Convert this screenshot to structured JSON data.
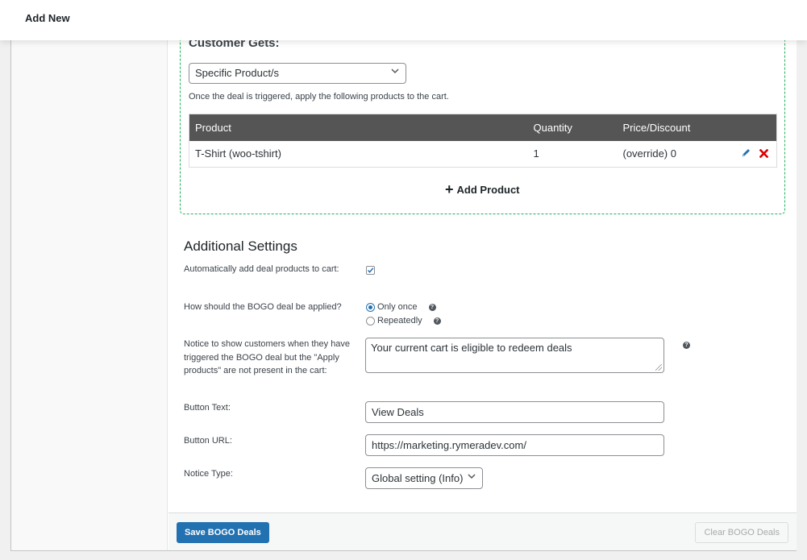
{
  "header": {
    "title": "Add New"
  },
  "customer_gets": {
    "title": "Customer Gets:",
    "type_select": {
      "value": "Specific Product/s"
    },
    "help_text": "Once the deal is triggered, apply the following products to the cart.",
    "table": {
      "columns": [
        "Product",
        "Quantity",
        "Price/Discount"
      ],
      "rows": [
        {
          "product": "T-Shirt (woo-tshirt)",
          "quantity": "1",
          "price": "(override) 0"
        }
      ]
    },
    "add_product_label": "Add Product"
  },
  "additional_settings": {
    "title": "Additional Settings",
    "auto_add": {
      "label": "Automatically add deal products to cart:",
      "checked": true
    },
    "apply_mode": {
      "label": "How should the BOGO deal be applied?",
      "options": [
        {
          "label": "Only once",
          "checked": true
        },
        {
          "label": "Repeatedly",
          "checked": false
        }
      ]
    },
    "notice": {
      "label": "Notice to show customers when they have triggered the BOGO deal but the \"Apply products\" are not present in the cart:",
      "value": "Your current cart is eligible to redeem deals"
    },
    "button_text": {
      "label": "Button Text:",
      "value": "View Deals"
    },
    "button_url": {
      "label": "Button URL:",
      "value": "https://marketing.rymeradev.com/"
    },
    "notice_type": {
      "label": "Notice Type:",
      "value": "Global setting (Info)"
    }
  },
  "footer": {
    "save_label": "Save BOGO Deals",
    "clear_label": "Clear BOGO Deals"
  },
  "colors": {
    "primary": "#2271b1",
    "dashed_border": "#1fb35b",
    "table_header": "#555555",
    "delete_icon": "#e00000",
    "edit_icon": "#2271b1"
  }
}
